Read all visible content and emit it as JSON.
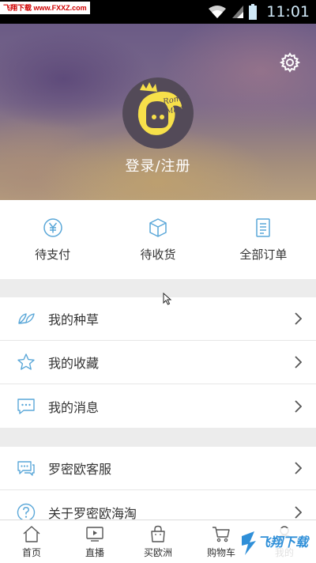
{
  "status_bar": {
    "watermark": "飞翔下载 www.FXXZ.com",
    "time": "11:01",
    "icons": [
      "wifi-icon",
      "signal-icon",
      "battery-icon"
    ]
  },
  "header": {
    "login_label": "登录/注册",
    "avatar_logo": "Romeo Mart",
    "settings_icon": "gear-icon"
  },
  "orders": [
    {
      "label": "待支付",
      "icon": "yuan-icon"
    },
    {
      "label": "待收货",
      "icon": "box-icon"
    },
    {
      "label": "全部订单",
      "icon": "document-icon"
    }
  ],
  "menu_group_1": [
    {
      "label": "我的种草",
      "icon": "leaf-icon"
    },
    {
      "label": "我的收藏",
      "icon": "star-icon"
    },
    {
      "label": "我的消息",
      "icon": "message-icon"
    }
  ],
  "menu_group_2": [
    {
      "label": "罗密欧客服",
      "icon": "chat-icon"
    },
    {
      "label": "关于罗密欧海淘",
      "icon": "help-icon"
    }
  ],
  "tabbar": [
    {
      "label": "首页",
      "icon": "home-icon"
    },
    {
      "label": "直播",
      "icon": "play-icon"
    },
    {
      "label": "买欧洲",
      "icon": "bag-icon"
    },
    {
      "label": "购物车",
      "icon": "cart-icon"
    },
    {
      "label": "我的",
      "icon": "user-icon"
    }
  ],
  "corner_watermark": {
    "text": "飞翔下载"
  },
  "colors": {
    "icon_blue": "#5aa7d8",
    "text": "#333333",
    "chevron": "#555555"
  }
}
